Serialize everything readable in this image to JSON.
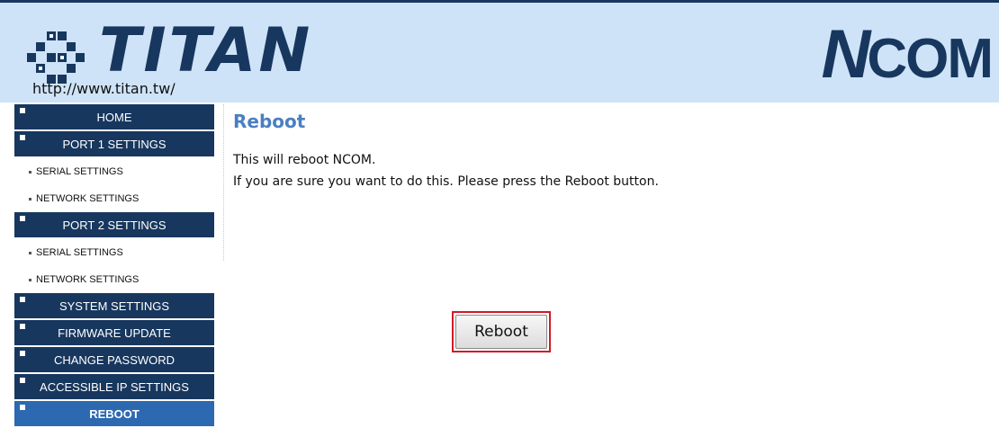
{
  "header": {
    "brand": "TITAN",
    "url": "http://www.titan.tw/",
    "product_logo_first": "N",
    "product_logo_rest": "COM"
  },
  "sidebar": {
    "items": [
      {
        "label": "HOME",
        "type": "main"
      },
      {
        "label": "PORT 1 SETTINGS",
        "type": "main"
      },
      {
        "label": "SERIAL SETTINGS",
        "type": "sub"
      },
      {
        "label": "NETWORK SETTINGS",
        "type": "sub"
      },
      {
        "label": "PORT 2 SETTINGS",
        "type": "main"
      },
      {
        "label": "SERIAL SETTINGS",
        "type": "sub"
      },
      {
        "label": "NETWORK SETTINGS",
        "type": "sub"
      },
      {
        "label": "SYSTEM SETTINGS",
        "type": "main"
      },
      {
        "label": "FIRMWARE UPDATE",
        "type": "main"
      },
      {
        "label": "CHANGE PASSWORD",
        "type": "main"
      },
      {
        "label": "ACCESSIBLE IP SETTINGS",
        "type": "main"
      },
      {
        "label": "REBOOT",
        "type": "main",
        "active": true
      }
    ]
  },
  "main": {
    "title": "Reboot",
    "line1": "This will reboot NCOM.",
    "line2": "If you are sure you want to do this. Please press the Reboot button.",
    "reboot_button": "Reboot"
  },
  "colors": {
    "header_bg": "#cfe3f8",
    "nav_bg": "#17375e",
    "nav_active_bg": "#2c69b0",
    "title": "#4a7fc1",
    "highlight_border": "#d11a2a"
  }
}
